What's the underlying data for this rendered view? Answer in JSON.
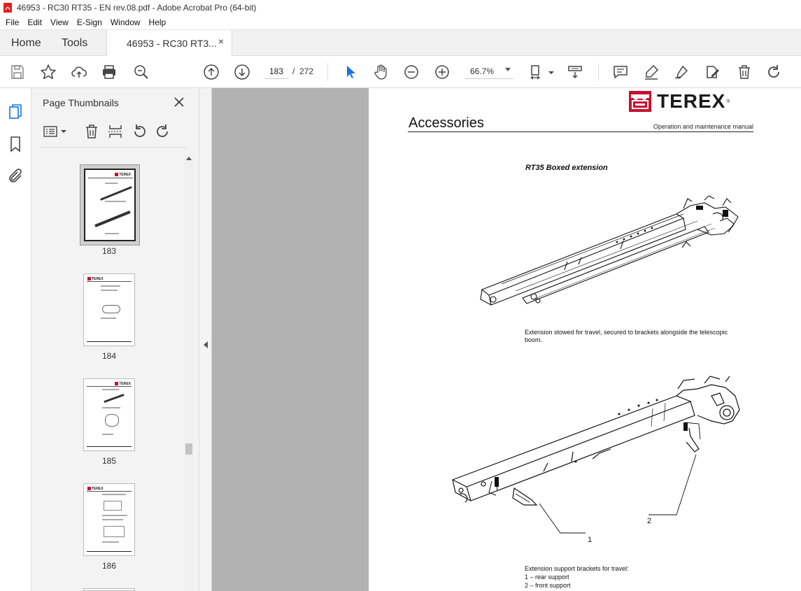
{
  "window": {
    "title": "46953 - RC30 RT35 - EN rev.08.pdf - Adobe Acrobat Pro (64-bit)",
    "icon": "pdf-icon"
  },
  "menu": [
    "File",
    "Edit",
    "View",
    "E-Sign",
    "Window",
    "Help"
  ],
  "tabs": {
    "home": "Home",
    "tools": "Tools",
    "document": "46953 - RC30 RT3...",
    "close": "×"
  },
  "toolbar": {
    "page_current": "183",
    "page_separator": "/",
    "page_total": "272",
    "zoom": "66.7%"
  },
  "thumbnails_panel": {
    "title": "Page Thumbnails",
    "pages": [
      "183",
      "184",
      "185",
      "186"
    ],
    "selected_page": "183"
  },
  "document": {
    "brand": "TEREX",
    "brand_mark": "®",
    "page_heading": "Accessories",
    "manual_label": "Operation and maintenance manual",
    "section_title": "RT35 Boxed extension",
    "caption_stowed": "Extension stowed for travel, secured to brackets alongside the telescopic boom.",
    "caption_brackets_title": "Extension support brackets for travel:",
    "caption_brackets_items": [
      "1 – rear support",
      "2 – front support"
    ],
    "callouts": [
      "1",
      "2"
    ]
  },
  "colors": {
    "brand_red": "#c8102e",
    "doc_background": "#b1b1b1",
    "accent_blue": "#1473e6"
  }
}
